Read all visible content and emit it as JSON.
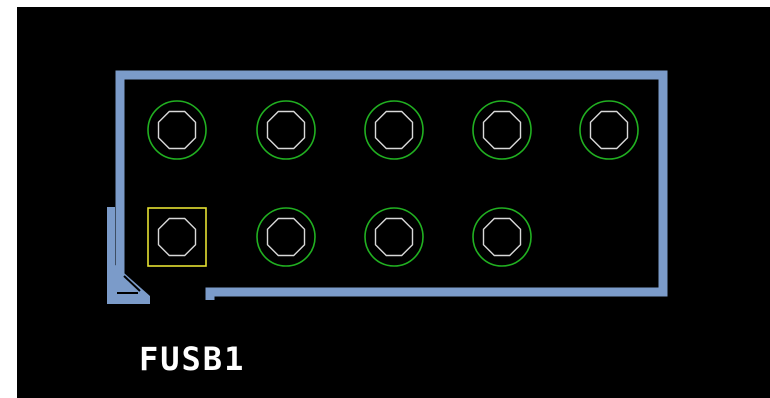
{
  "footprint": {
    "designator": "FUSB1",
    "pad_count": 9,
    "pin1_marker": "square"
  },
  "colors": {
    "background": "#000000",
    "outline": "#7b9bc9",
    "annular_ring": "#21b021",
    "drill": "#d9d9d9",
    "pin1_pad": "#e6e233",
    "label": "#ffffff",
    "border": "#ffffff"
  }
}
